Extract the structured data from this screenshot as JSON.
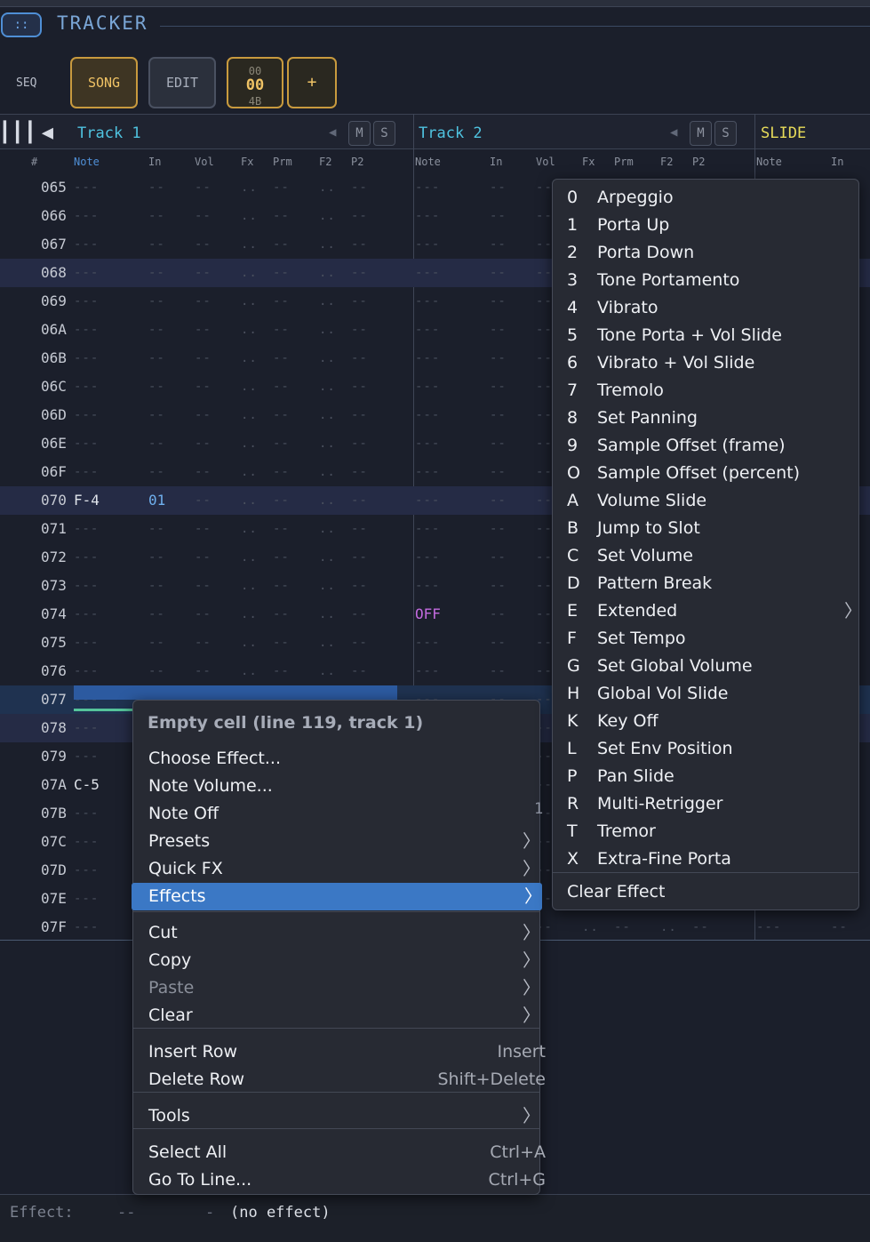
{
  "header": {
    "menu_icon": "::",
    "title": "TRACKER",
    "seq_label": "SEQ",
    "song_label": "SONG",
    "edit_label": "EDIT",
    "counter": {
      "top": "00",
      "mid": "00",
      "bottom": "4B"
    },
    "add_label": "+"
  },
  "tracks": {
    "transport": "▎▎▎◀",
    "track1": "Track 1",
    "track2": "Track 2",
    "slide": "SLIDE",
    "mute": "M",
    "solo": "S",
    "tri": "◀"
  },
  "columns": {
    "hash": "#",
    "t1": [
      "Note",
      "In",
      "Vol",
      "Fx",
      "Prm",
      "F2",
      "P2"
    ],
    "t2": [
      "Note",
      "In",
      "Vol",
      "Fx",
      "Prm",
      "F2",
      "P2"
    ],
    "t3": [
      "Note",
      "In"
    ]
  },
  "rows": [
    {
      "n": "065"
    },
    {
      "n": "066"
    },
    {
      "n": "067"
    },
    {
      "n": "068",
      "hl": true
    },
    {
      "n": "069"
    },
    {
      "n": "06A"
    },
    {
      "n": "06B"
    },
    {
      "n": "06C"
    },
    {
      "n": "06D"
    },
    {
      "n": "06E"
    },
    {
      "n": "06F"
    },
    {
      "n": "070",
      "hl": true,
      "note": "F-4",
      "ins": "01"
    },
    {
      "n": "071"
    },
    {
      "n": "072"
    },
    {
      "n": "073"
    },
    {
      "n": "074",
      "t2note": "OFF"
    },
    {
      "n": "075"
    },
    {
      "n": "076"
    },
    {
      "n": "077",
      "cur": true
    },
    {
      "n": "078",
      "hl": true
    },
    {
      "n": "079"
    },
    {
      "n": "07A",
      "note": "C-5"
    },
    {
      "n": "07B"
    },
    {
      "n": "07C"
    },
    {
      "n": "07D"
    },
    {
      "n": "07E"
    },
    {
      "n": "07F"
    }
  ],
  "context_menu": {
    "header": "Empty cell  (line 119, track 1)",
    "items": [
      {
        "label": "Choose Effect..."
      },
      {
        "label": "Note Volume..."
      },
      {
        "label": "Note Off"
      },
      {
        "label": "Presets",
        "arrow": "〉"
      },
      {
        "label": "Quick FX",
        "arrow": "〉"
      },
      {
        "label": "Effects",
        "arrow": "〉",
        "active": true
      },
      {
        "label": "Cut",
        "arrow": "〉"
      },
      {
        "label": "Copy",
        "arrow": "〉"
      },
      {
        "label": "Paste",
        "arrow": "〉",
        "disabled": true
      },
      {
        "label": "Clear",
        "arrow": "〉"
      },
      {
        "label": "Insert Row",
        "shortcut": "Insert"
      },
      {
        "label": "Delete Row",
        "shortcut": "Shift+Delete"
      },
      {
        "label": "Tools",
        "arrow": "〉"
      },
      {
        "label": "Select All",
        "shortcut": "Ctrl+A"
      },
      {
        "label": "Go To Line...",
        "shortcut": "Ctrl+G"
      }
    ]
  },
  "effects_menu": {
    "items": [
      {
        "key": "0",
        "label": "Arpeggio"
      },
      {
        "key": "1",
        "label": "Porta Up"
      },
      {
        "key": "2",
        "label": "Porta Down"
      },
      {
        "key": "3",
        "label": "Tone Portamento"
      },
      {
        "key": "4",
        "label": "Vibrato"
      },
      {
        "key": "5",
        "label": "Tone Porta + Vol Slide"
      },
      {
        "key": "6",
        "label": "Vibrato + Vol Slide"
      },
      {
        "key": "7",
        "label": "Tremolo"
      },
      {
        "key": "8",
        "label": "Set Panning"
      },
      {
        "key": "9",
        "label": "Sample Offset (frame)"
      },
      {
        "key": "O",
        "label": "Sample Offset (percent)"
      },
      {
        "key": "A",
        "label": "Volume Slide"
      },
      {
        "key": "B",
        "label": "Jump to Slot"
      },
      {
        "key": "C",
        "label": "Set Volume"
      },
      {
        "key": "D",
        "label": "Pattern Break"
      },
      {
        "key": "E",
        "label": "Extended",
        "arrow": "〉"
      },
      {
        "key": "F",
        "label": "Set Tempo"
      },
      {
        "key": "G",
        "label": "Set Global Volume"
      },
      {
        "key": "H",
        "label": "Global Vol Slide"
      },
      {
        "key": "K",
        "label": "Key Off"
      },
      {
        "key": "L",
        "label": "Set Env Position"
      },
      {
        "key": "P",
        "label": "Pan Slide"
      },
      {
        "key": "R",
        "label": "Multi-Retrigger"
      },
      {
        "key": "T",
        "label": "Tremor"
      },
      {
        "key": "X",
        "label": "Extra-Fine Porta"
      }
    ],
    "clear": "Clear Effect"
  },
  "status": {
    "label": "Effect:",
    "v1": "--",
    "v2": "-",
    "v3": "(no effect)"
  },
  "partial_glyph": "1"
}
